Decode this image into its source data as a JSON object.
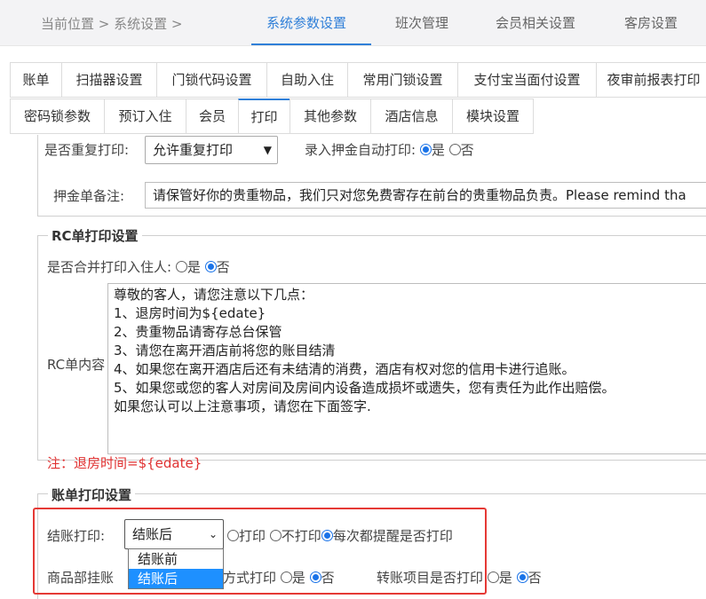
{
  "header": {
    "breadcrumb": "当前位置 > 系统设置 >",
    "nav": [
      "系统参数设置",
      "班次管理",
      "会员相关设置",
      "客房设置"
    ]
  },
  "tabs_row1": [
    "账单",
    "扫描器设置",
    "门锁代码设置",
    "自助入住",
    "常用门锁设置",
    "支付宝当面付设置",
    "夜审前报表打印"
  ],
  "tabs_row2": [
    "密码锁参数",
    "预订入住",
    "会员",
    "打印",
    "其他参数",
    "酒店信息",
    "模块设置"
  ],
  "deposit": {
    "repeat_label": "是否重复打印:",
    "repeat_value": "允许重复打印",
    "auto_print_label": "录入押金自动打印:",
    "yes": "是",
    "no": "否",
    "remark_label": "押金单备注:",
    "remark_value": "请保管好你的贵重物品，我们只对您免费寄存在前台的贵重物品负责。Please remind tha"
  },
  "rc": {
    "legend": "RC单打印设置",
    "merge_label": "是否合并打印入住人:",
    "yes": "是",
    "no": "否",
    "content_label": "RC单内容",
    "content_lines": [
      "尊敬的客人，请您注意以下几点：",
      "1、退房时间为${edate}",
      "2、贵重物品请寄存总台保管",
      "3、请您在离开酒店前将您的账目结清",
      "4、如果您在离开酒店后还有未结清的消费，酒店有权对您的信用卡进行追账。",
      "5、如果您或您的客人对房间及房间内设备造成损坏或遗失，您有责任为此作出赔偿。",
      "如果您认可以上注意事项，请您在下面签字."
    ],
    "note": "注：退房时间=${edate}"
  },
  "bill": {
    "legend": "账单打印设置",
    "checkout_label": "结账打印:",
    "checkout_value": "结账后",
    "options": [
      "结账前",
      "结账后"
    ],
    "print": "打印",
    "no_print": "不打印",
    "ask_each": "每次都提醒是否打印",
    "goods_label_start": "商品部挂账",
    "goods_label_end": "方式打印",
    "yes": "是",
    "no": "否",
    "transfer_label": "转账项目是否打印",
    "transfer_yes": "是",
    "transfer_no": "否"
  }
}
